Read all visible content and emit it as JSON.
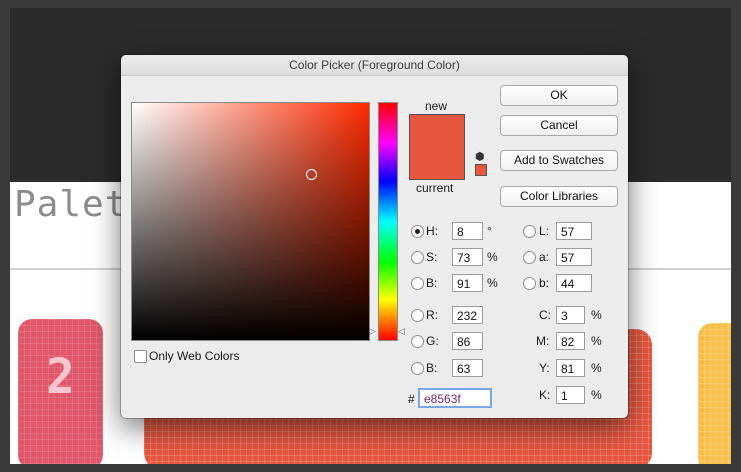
{
  "background": {
    "palette_heading": "Palet",
    "card_number": "2",
    "colors": {
      "card_left": "#e0566a",
      "card_mid": "#e8563f",
      "card_right": "#f8c04a",
      "dark_band": "#2b2b2b"
    }
  },
  "dialog": {
    "title": "Color Picker (Foreground Color)",
    "swatch": {
      "new_label": "new",
      "current_label": "current",
      "new_color": "#e8563f",
      "current_color": "#e8563f"
    },
    "buttons": {
      "ok": "OK",
      "cancel": "Cancel",
      "add_to_swatches": "Add to Swatches",
      "color_libraries": "Color Libraries"
    },
    "only_web_colors": "Only Web Colors",
    "hsb": [
      {
        "label": "H:",
        "value": "8",
        "unit": "°",
        "selected": true
      },
      {
        "label": "S:",
        "value": "73",
        "unit": "%",
        "selected": false
      },
      {
        "label": "B:",
        "value": "91",
        "unit": "%",
        "selected": false
      }
    ],
    "rgb": [
      {
        "label": "R:",
        "value": "232"
      },
      {
        "label": "G:",
        "value": "86"
      },
      {
        "label": "B:",
        "value": "63"
      }
    ],
    "lab": [
      {
        "label": "L:",
        "value": "57"
      },
      {
        "label": "a:",
        "value": "57"
      },
      {
        "label": "b:",
        "value": "44"
      }
    ],
    "cmyk": [
      {
        "label": "C:",
        "value": "3",
        "unit": "%"
      },
      {
        "label": "M:",
        "value": "82",
        "unit": "%"
      },
      {
        "label": "Y:",
        "value": "81",
        "unit": "%"
      },
      {
        "label": "K:",
        "value": "1",
        "unit": "%"
      }
    ],
    "hex_prefix": "#",
    "hex_value": "e8563f"
  }
}
